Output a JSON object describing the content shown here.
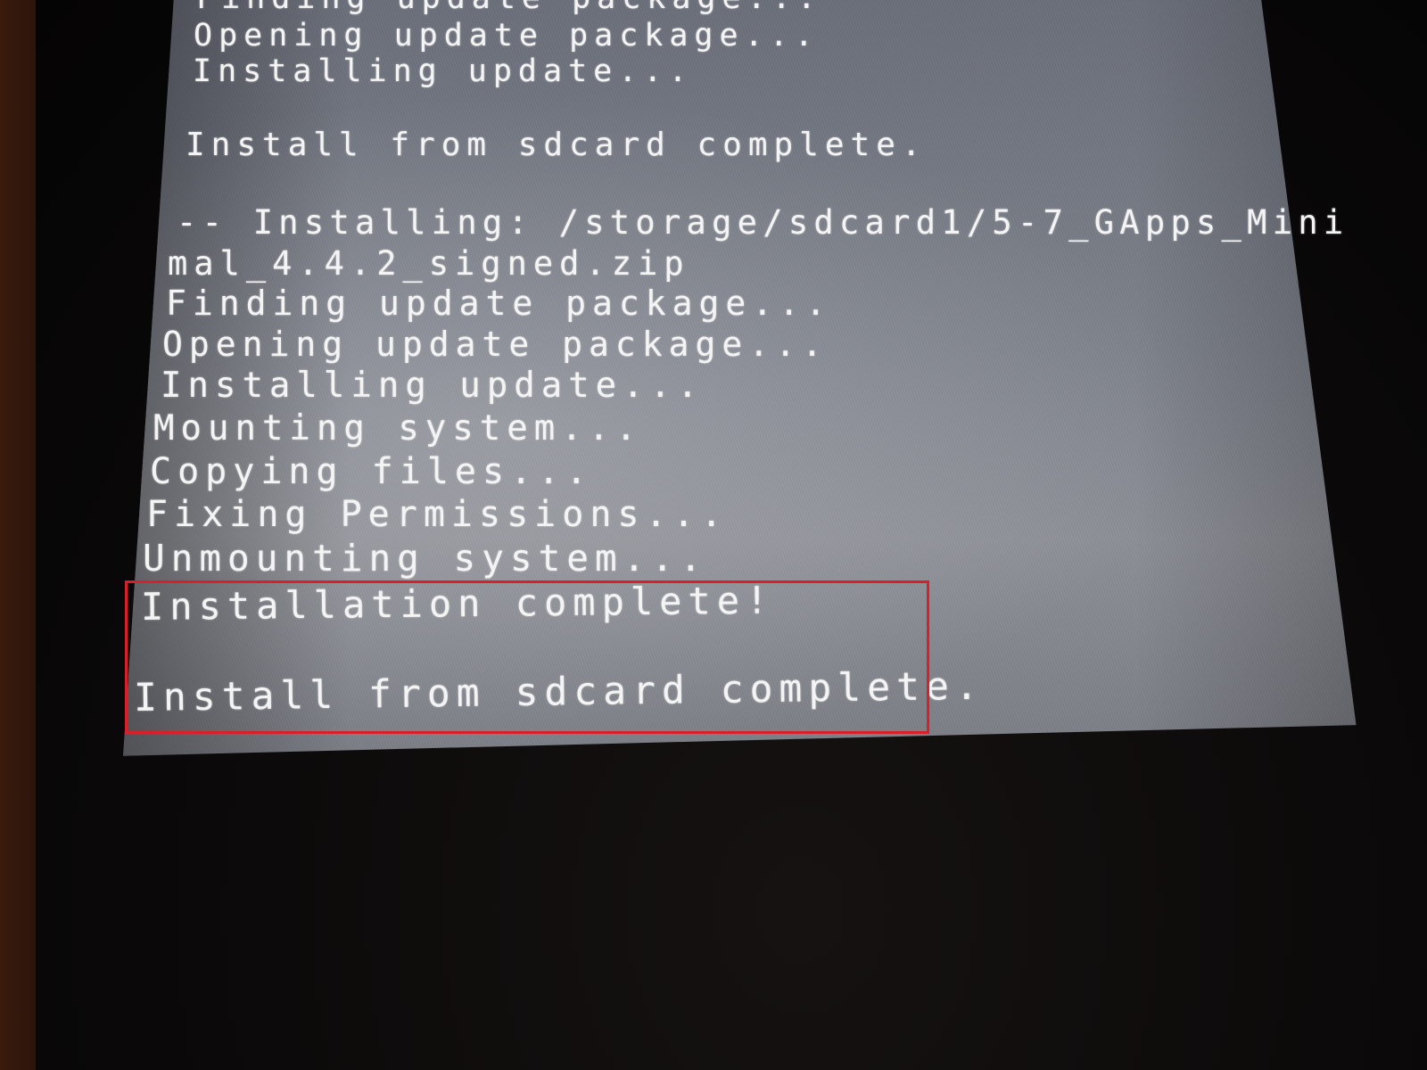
{
  "recovery_log": {
    "lines": [
      "Finding update package...",
      "Opening update package...",
      "Installing update...",
      "Install from sdcard complete.",
      "-- Installing: /storage/sdcard1/5-7_GApps_Mini",
      "mal_4.4.2_signed.zip",
      "Finding update package...",
      "Opening update package...",
      "Installing update...",
      "Mounting system...",
      "Copying files...",
      "Fixing Permissions...",
      "Unmounting system...",
      "Installation complete!",
      "Install from sdcard complete."
    ]
  },
  "annotation": {
    "highlight_color": "#d8202a"
  },
  "colors": {
    "screen_text": "#f4f4f4",
    "screen_background": "#7e828b"
  }
}
